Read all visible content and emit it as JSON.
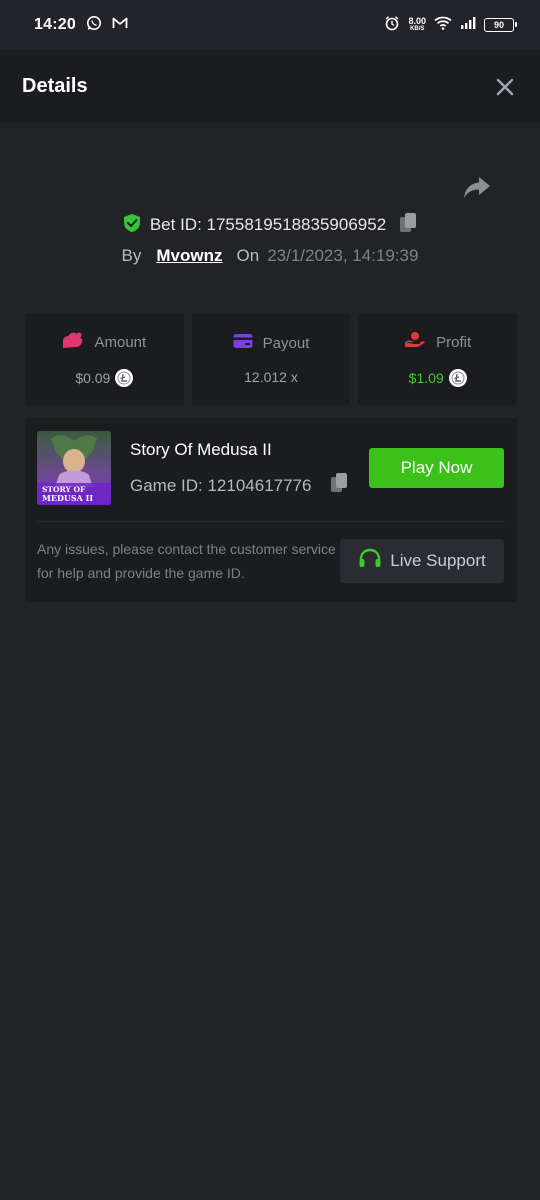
{
  "status_bar": {
    "time": "14:20",
    "net_speed_value": "8.00",
    "net_speed_unit": "KB/S",
    "battery": "90"
  },
  "header": {
    "title": "Details"
  },
  "bet": {
    "id_label": "Bet ID: 1755819518835906952",
    "by_label": "By",
    "user": "Mvownz",
    "on_label": "On",
    "datetime": "23/1/2023, 14:19:39"
  },
  "stats": {
    "amount": {
      "label": "Amount",
      "value": "$0.09"
    },
    "payout": {
      "label": "Payout",
      "value": "12.012 x"
    },
    "profit": {
      "label": "Profit",
      "value": "$1.09"
    }
  },
  "game": {
    "name": "Story Of Medusa II",
    "id_label": "Game ID: 12104617776",
    "thumb_line1": "STORY OF",
    "thumb_line2": "MEDUSA II",
    "play_label": "Play Now",
    "help_text": "Any issues, please contact the customer service for help and provide the game ID.",
    "support_label": "Live Support"
  },
  "colors": {
    "accent_green": "#3bc117",
    "profit_green": "#3ccd2a",
    "amount_icon": "#e0356f",
    "payout_icon": "#7b3fe4",
    "profit_icon": "#e03a3a"
  },
  "icons": [
    "whatsapp-icon",
    "gmail-icon",
    "alarm-icon",
    "wifi-icon",
    "signal-icon",
    "close-icon",
    "share-icon",
    "shield-check-icon",
    "copy-icon",
    "amount-icon",
    "payout-card-icon",
    "profit-hand-icon",
    "litecoin-icon",
    "headset-icon"
  ]
}
